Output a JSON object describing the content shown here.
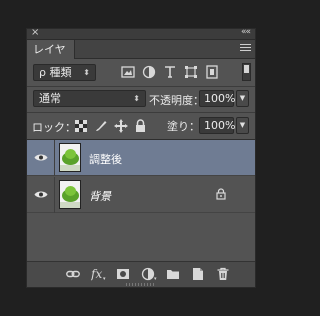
{
  "panel": {
    "close_glyph": "×",
    "collapse_glyph": "««",
    "tab_label": "レイヤー",
    "menu_icon": "panel-menu-icon"
  },
  "filter": {
    "kind_label": "ρ 種類",
    "icons": [
      "image-filter-icon",
      "adjustment-filter-icon",
      "type-filter-icon",
      "shape-filter-icon",
      "smartobject-filter-icon"
    ]
  },
  "blend": {
    "mode_value": "通常",
    "opacity_label": "不透明度：",
    "opacity_value": "100%"
  },
  "locks": {
    "lock_label": "ロック：",
    "fill_label": "塗り：",
    "fill_value": "100%"
  },
  "layers": [
    {
      "name": "調整後",
      "selected": true,
      "italic": false,
      "locked": false
    },
    {
      "name": "背景",
      "selected": false,
      "italic": true,
      "locked": true
    }
  ],
  "footer_icons": [
    "link-layers-icon",
    "fx-icon",
    "mask-icon",
    "adjustment-layer-icon",
    "group-folder-icon",
    "new-layer-icon",
    "trash-icon"
  ],
  "colors": {
    "panel": "#535353",
    "selected_layer": "#6f7c93",
    "background": "#202020"
  }
}
